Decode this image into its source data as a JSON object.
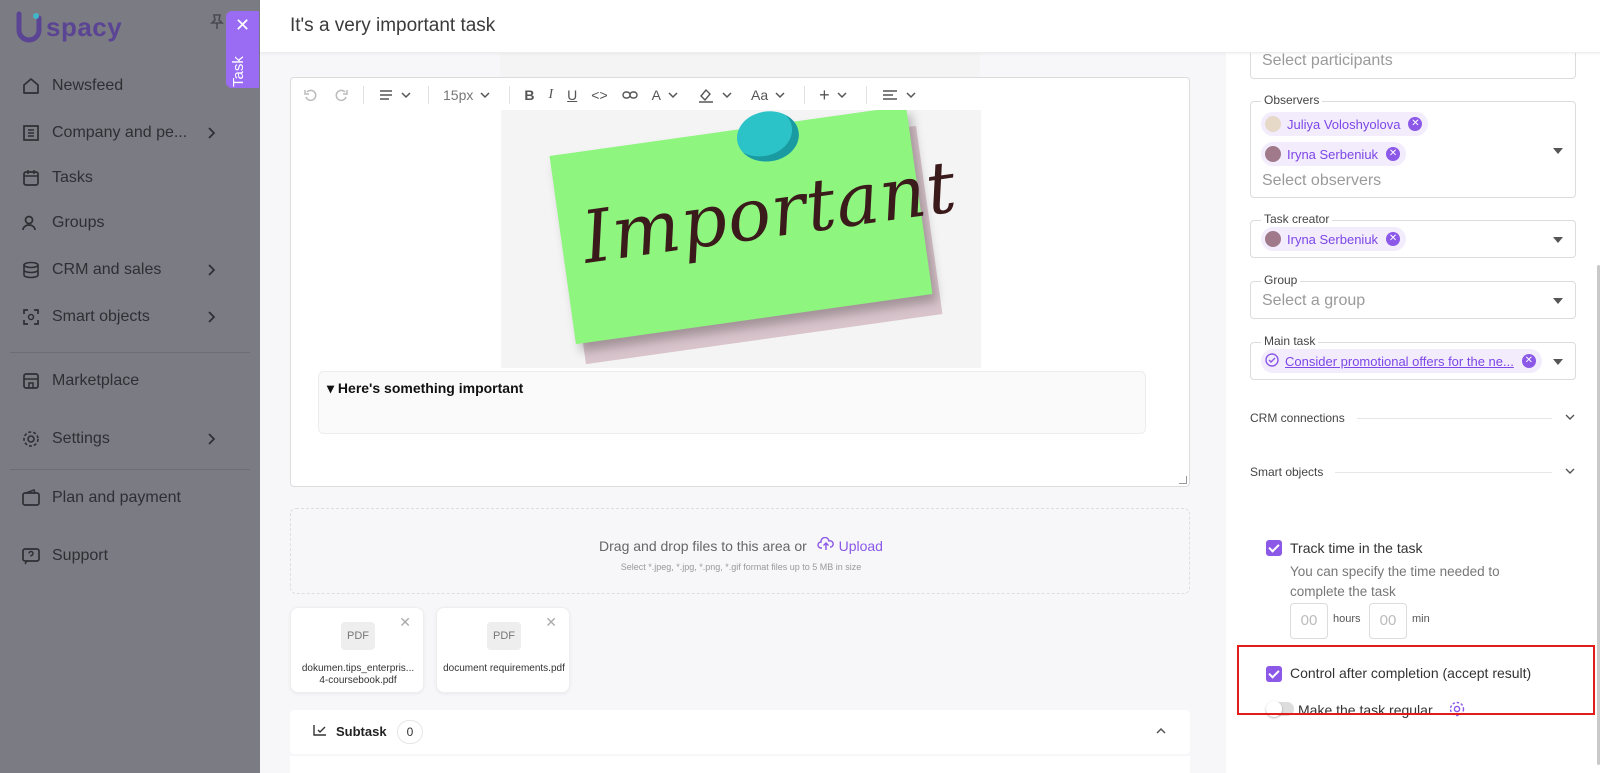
{
  "brand": {
    "name": "spacy"
  },
  "sidebar": {
    "items": [
      {
        "label": "Newsfeed",
        "icon": "home-icon"
      },
      {
        "label": "Company and pe...",
        "icon": "company-icon"
      },
      {
        "label": "Tasks",
        "icon": "calendar-icon"
      },
      {
        "label": "Groups",
        "icon": "users-icon"
      },
      {
        "label": "CRM and sales",
        "icon": "database-icon"
      },
      {
        "label": "Smart objects",
        "icon": "scan-icon"
      },
      {
        "label": "Marketplace",
        "icon": "store-icon"
      },
      {
        "label": "Settings",
        "icon": "gear-icon"
      },
      {
        "label": "Plan and payment",
        "icon": "wallet-icon"
      },
      {
        "label": "Support",
        "icon": "help-icon"
      }
    ]
  },
  "task_tab": {
    "label": "Task"
  },
  "header": {
    "title": "It's a very important task"
  },
  "editor": {
    "font_size": "15px",
    "image_text": "Important",
    "details_summary": "Here's something important"
  },
  "upload": {
    "text": "Drag and drop files to this area or",
    "link": "Upload",
    "hint": "Select *.jpeg, *.jpg, *.png, *.gif format files up to 5 MB in size"
  },
  "files": [
    {
      "type": "PDF",
      "name": "dokumen.tips_enterpris... 4-coursebook.pdf"
    },
    {
      "type": "PDF",
      "name": "document requirements.pdf"
    }
  ],
  "subtask": {
    "label": "Subtask",
    "count": "0"
  },
  "right": {
    "participants_placeholder": "Select participants",
    "observers_label": "Observers",
    "observers": [
      "Juliya Voloshyolova",
      "Iryna Serbeniuk"
    ],
    "observers_placeholder": "Select observers",
    "creator_label": "Task creator",
    "creator": "Iryna Serbeniuk",
    "group_label": "Group",
    "group_placeholder": "Select a group",
    "main_task_label": "Main task",
    "main_task": "Consider promotional offers for the ne...",
    "crm_label": "CRM connections",
    "smart_label": "Smart objects",
    "track_time_label": "Track time in the task",
    "track_time_hint": "You can specify the time needed to complete the task",
    "hours_value": "00",
    "hours_unit": "hours",
    "min_value": "00",
    "min_unit": "min",
    "control_label": "Control after completion (accept result)",
    "regular_label": "Make the task regular"
  },
  "colors": {
    "accent": "#8b58e8",
    "highlight": "#e21c1c",
    "sidebar_dim": "#7b7b84"
  }
}
